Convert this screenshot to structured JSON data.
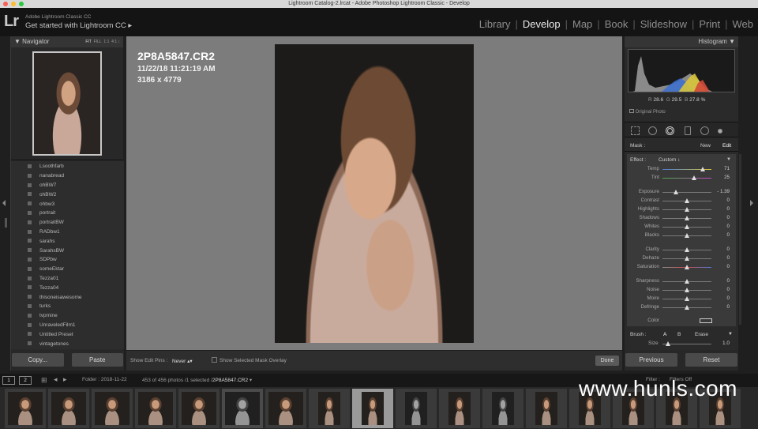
{
  "window": {
    "title": "Lightroom Catalog-2.lrcat - Adobe Photoshop Lightroom Classic - Develop"
  },
  "identity": {
    "logo": "Lr",
    "line1": "Adobe Lightroom Classic CC",
    "line2": "Get started with Lightroom CC",
    "arrow": "▸"
  },
  "modules": [
    "Library",
    "Develop",
    "Map",
    "Book",
    "Slideshow",
    "Print",
    "Web"
  ],
  "active_module": "Develop",
  "navigator": {
    "title": "Navigator",
    "zoom_fit": "FIT",
    "zoom_fill": "FILL",
    "zoom_1": "1:1",
    "zoom_4": "4:1 ↕"
  },
  "presets": [
    "Lsoothfarb",
    "nanabread",
    "ohBW7",
    "ohBW2",
    "ohbw3",
    "portrait",
    "portraitBW",
    "RADbw1",
    "sarahs",
    "SarahsBW",
    "SDPbw",
    "someEktar",
    "Tezza01",
    "Tezza04",
    "thisoneisawesome",
    "turks",
    "tvpmine",
    "UnraveledFilm1",
    "Untitled Preset",
    "vintagetones"
  ],
  "left_buttons": {
    "copy": "Copy...",
    "paste": "Paste"
  },
  "photo_info": {
    "name": "2P8A5847.CR2",
    "datetime": "11/22/18 11:21:19 AM",
    "dimensions": "3186 x 4779"
  },
  "toolbar": {
    "edit_pins_label": "Show Edit Pins :",
    "edit_pins_value": "Never ▴▾",
    "overlay_label": "Show Selected Mask Overlay",
    "done": "Done"
  },
  "histogram": {
    "title": "Histogram",
    "r_label": "R",
    "r": "28.6",
    "g_label": "G",
    "g": "29.5",
    "b_label": "B",
    "b": "27.8 %",
    "original_photo": "Original Photo"
  },
  "mask": {
    "label": "Mask :",
    "new": "New",
    "edit": "Edit"
  },
  "effect": {
    "label": "Effect :",
    "value": "Custom ↕"
  },
  "sliders": [
    {
      "label": "Temp",
      "value": "71",
      "pos": 0.82
    },
    {
      "label": "Tint",
      "value": "25",
      "pos": 0.64
    },
    {
      "label": "Exposure",
      "value": "- 1.39",
      "pos": 0.28
    },
    {
      "label": "Contrast",
      "value": "0",
      "pos": 0.5
    },
    {
      "label": "Highlights",
      "value": "0",
      "pos": 0.5
    },
    {
      "label": "Shadows",
      "value": "0",
      "pos": 0.5
    },
    {
      "label": "Whites",
      "value": "0",
      "pos": 0.5
    },
    {
      "label": "Blacks",
      "value": "0",
      "pos": 0.5
    },
    {
      "label": "Clarity",
      "value": "0",
      "pos": 0.5
    },
    {
      "label": "Dehaze",
      "value": "0",
      "pos": 0.5
    },
    {
      "label": "Saturation",
      "value": "0",
      "pos": 0.5
    },
    {
      "label": "Sharpness",
      "value": "0",
      "pos": 0.5
    },
    {
      "label": "Noise",
      "value": "0",
      "pos": 0.5
    },
    {
      "label": "Moire",
      "value": "0",
      "pos": 0.5
    },
    {
      "label": "Defringe",
      "value": "0",
      "pos": 0.5
    }
  ],
  "color_label": "Color",
  "brush": {
    "label": "Brush :",
    "a": "A",
    "b": "B",
    "erase": "Erase",
    "size_label": "Size",
    "size_value": "1.0"
  },
  "right_buttons": {
    "previous": "Previous",
    "reset": "Reset"
  },
  "filmstrip": {
    "page1": "1",
    "page2": "2",
    "folder": "Folder : 2018-11-22",
    "count": "453 of 456 photos /1 selected /",
    "selected_file": "2P8A5847.CR2",
    "dropdown": "▾",
    "filter": "Filter :",
    "filters_off": "Filters Off"
  },
  "watermark": "www.hunls.com",
  "colors": {
    "accent_text": "#e8e8e8",
    "panel": "#2a2a2a",
    "canvas_gray": "#7c7c7c"
  }
}
